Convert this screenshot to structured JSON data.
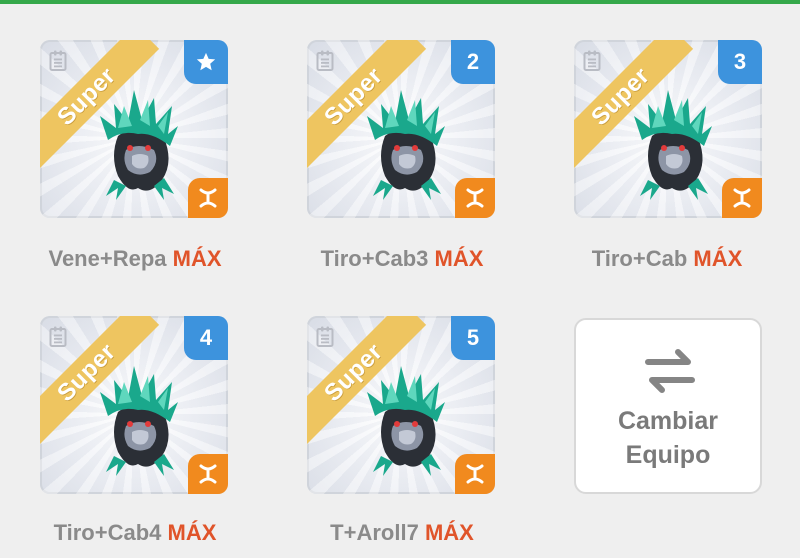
{
  "theme": {
    "accent_blue": "#3d93dd",
    "accent_orange": "#f18a1e",
    "banner_gold": "#eec560",
    "max_red": "#e0542a",
    "top_strip_green": "#35a84a"
  },
  "team_cards": [
    {
      "name": "Vene+Repa",
      "max": "MÁX",
      "badge": "",
      "badge_icon": "star-icon",
      "rarity": "Super",
      "element_icon": "element-icon"
    },
    {
      "name": "Tiro+Cab3",
      "max": "MÁX",
      "badge": "2",
      "rarity": "Super",
      "element_icon": "element-icon"
    },
    {
      "name": "Tiro+Cab",
      "max": "MÁX",
      "badge": "3",
      "rarity": "Super",
      "element_icon": "element-icon"
    },
    {
      "name": "Tiro+Cab4",
      "max": "MÁX",
      "badge": "4",
      "rarity": "Super",
      "element_icon": "element-icon"
    },
    {
      "name": "T+Aroll7",
      "max": "MÁX",
      "badge": "5",
      "rarity": "Super",
      "element_icon": "element-icon"
    }
  ],
  "swap_button": {
    "line1": "Cambiar",
    "line2": "Equipo",
    "icon": "swap-arrows-icon"
  }
}
